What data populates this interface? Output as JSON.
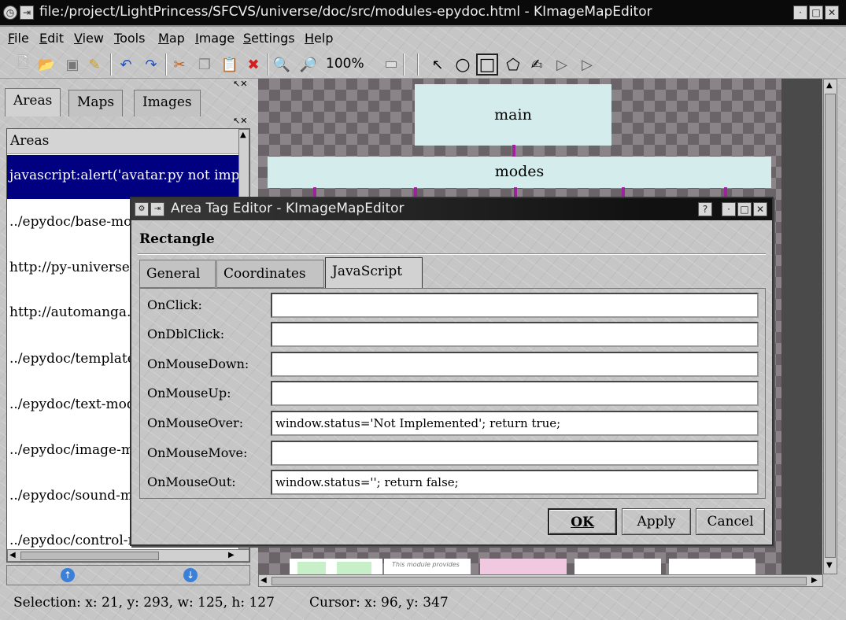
{
  "window": {
    "title": "file:/project/LightPrincess/SFCVS/universe/doc/src/modules-epydoc.html - KImageMapEditor"
  },
  "menu": [
    "File",
    "Edit",
    "View",
    "Tools",
    "Map",
    "Image",
    "Settings",
    "Help"
  ],
  "toolbar": {
    "zoom": "100%"
  },
  "left_panel": {
    "tabs": [
      "Areas",
      "Maps",
      "Images"
    ],
    "list_header": "Areas",
    "items": [
      "javascript:alert('avatar.py not implemented')",
      "../epydoc/base-module.html",
      "http://py-universe.sourceforge.net",
      "http://automanga.sourceforge.net",
      "../epydoc/template-module.html",
      "../epydoc/text-module.html",
      "../epydoc/image-module.html",
      "../epydoc/sound-module.html",
      "../epydoc/control-module.html"
    ]
  },
  "canvas": {
    "nodes": [
      "main",
      "modes"
    ],
    "thumb_text": "This module provides"
  },
  "dialog": {
    "title": "Area Tag Editor - KImageMapEditor",
    "heading": "Rectangle",
    "tabs": [
      "General",
      "Coordinates",
      "JavaScript"
    ],
    "fields": [
      {
        "label": "OnClick:",
        "value": ""
      },
      {
        "label": "OnDblClick:",
        "value": ""
      },
      {
        "label": "OnMouseDown:",
        "value": ""
      },
      {
        "label": "OnMouseUp:",
        "value": ""
      },
      {
        "label": "OnMouseOver:",
        "value": "window.status='Not Implemented'; return true;"
      },
      {
        "label": "OnMouseMove:",
        "value": ""
      },
      {
        "label": "OnMouseOut:",
        "value": "window.status=''; return false;"
      }
    ],
    "buttons": {
      "ok": "OK",
      "apply": "Apply",
      "cancel": "Cancel"
    }
  },
  "status": {
    "selection": "Selection: x: 21, y: 293, w: 125, h: 127",
    "cursor": "Cursor: x: 96, y: 347"
  },
  "colors": {
    "selection": "#000080",
    "node_fill": "#d4ecec",
    "connector": "#a020a0"
  }
}
